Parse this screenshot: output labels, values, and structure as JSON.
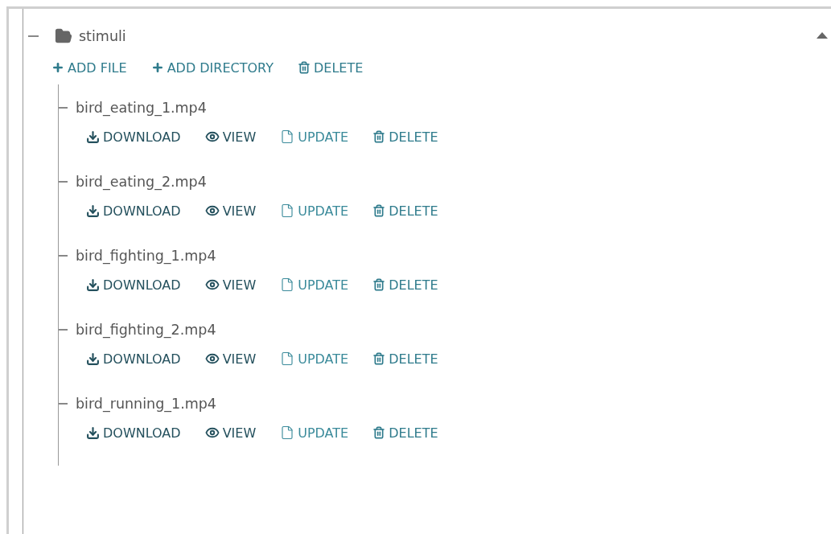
{
  "panel": {
    "expanded": true
  },
  "folder": {
    "name": "stimuli",
    "expanded": true,
    "actions": [
      {
        "label": "ADD FILE",
        "kind": "add"
      },
      {
        "label": "ADD DIRECTORY",
        "kind": "add"
      },
      {
        "label": "DELETE",
        "kind": "delete"
      }
    ],
    "files": [
      {
        "name": "bird_eating_1.mp4",
        "actions": [
          {
            "label": "DOWNLOAD",
            "kind": "download"
          },
          {
            "label": "VIEW",
            "kind": "view"
          },
          {
            "label": "UPDATE",
            "kind": "update"
          },
          {
            "label": "DELETE",
            "kind": "delete"
          }
        ]
      },
      {
        "name": "bird_eating_2.mp4",
        "actions": [
          {
            "label": "DOWNLOAD",
            "kind": "download"
          },
          {
            "label": "VIEW",
            "kind": "view"
          },
          {
            "label": "UPDATE",
            "kind": "update"
          },
          {
            "label": "DELETE",
            "kind": "delete"
          }
        ]
      },
      {
        "name": "bird_fighting_1.mp4",
        "actions": [
          {
            "label": "DOWNLOAD",
            "kind": "download"
          },
          {
            "label": "VIEW",
            "kind": "view"
          },
          {
            "label": "UPDATE",
            "kind": "update"
          },
          {
            "label": "DELETE",
            "kind": "delete"
          }
        ]
      },
      {
        "name": "bird_fighting_2.mp4",
        "actions": [
          {
            "label": "DOWNLOAD",
            "kind": "download"
          },
          {
            "label": "VIEW",
            "kind": "view"
          },
          {
            "label": "UPDATE",
            "kind": "update"
          },
          {
            "label": "DELETE",
            "kind": "delete"
          }
        ]
      },
      {
        "name": "bird_running_1.mp4",
        "actions": [
          {
            "label": "DOWNLOAD",
            "kind": "download"
          },
          {
            "label": "VIEW",
            "kind": "view"
          },
          {
            "label": "UPDATE",
            "kind": "update"
          },
          {
            "label": "DELETE",
            "kind": "delete"
          }
        ]
      }
    ]
  }
}
